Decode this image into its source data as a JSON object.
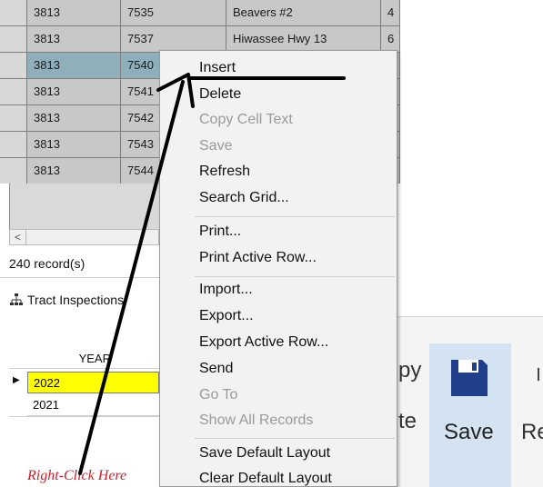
{
  "grid": {
    "rows": [
      {
        "c1": "3813",
        "c2": "7535",
        "c3": "Beavers #2",
        "c4": "4"
      },
      {
        "c1": "3813",
        "c2": "7537",
        "c3": "Hiwassee Hwy 13",
        "c4": "6"
      },
      {
        "c1": "3813",
        "c2": "7540",
        "c3": "",
        "c4": ""
      },
      {
        "c1": "3813",
        "c2": "7541",
        "c3": "",
        "c4": ""
      },
      {
        "c1": "3813",
        "c2": "7542",
        "c3": "",
        "c4": ""
      },
      {
        "c1": "3813",
        "c2": "7543",
        "c3": "",
        "c4": ""
      },
      {
        "c1": "3813",
        "c2": "7544",
        "c3": "",
        "c4": ""
      }
    ],
    "scroll_left_glyph": "<"
  },
  "status": {
    "records": "240 record(s)"
  },
  "tract": {
    "label": "Tract Inspections"
  },
  "years": {
    "header": "YEAR",
    "rows": [
      "2022",
      "2021"
    ],
    "row_indicator": "▶"
  },
  "annotation": {
    "text": "Right-Click Here"
  },
  "context_menu": {
    "items": [
      {
        "label": "Insert",
        "enabled": true
      },
      {
        "label": "Delete",
        "enabled": true
      },
      {
        "label": "Copy Cell Text",
        "enabled": false
      },
      {
        "label": "Save",
        "enabled": false
      },
      {
        "label": "Refresh",
        "enabled": true
      },
      {
        "label": "Search Grid...",
        "enabled": true
      },
      {
        "label": "Print...",
        "enabled": true
      },
      {
        "label": "Print Active Row...",
        "enabled": true
      },
      {
        "label": "Import...",
        "enabled": true
      },
      {
        "label": "Export...",
        "enabled": true
      },
      {
        "label": "Export Active Row...",
        "enabled": true
      },
      {
        "label": "Send",
        "enabled": true
      },
      {
        "label": "Go To",
        "enabled": false
      },
      {
        "label": "Show All Records",
        "enabled": false
      },
      {
        "label": "Save Default Layout",
        "enabled": true
      },
      {
        "label": "Clear Default Layout",
        "enabled": true
      }
    ]
  },
  "ribbon": {
    "save_label": "Save",
    "fragment_left_top": "py",
    "fragment_left_bottom": "te",
    "fragment_right": "Re"
  },
  "colors": {
    "selected_row": "#8fb0bb",
    "year_highlight": "#ffff00",
    "annotation_red": "#cc1f2a",
    "save_icon": "#1f3f8a",
    "ribbon_hover": "#d4e3f2"
  },
  "icons": {
    "save": "floppy-disk-icon",
    "tract": "hierarchy-icon",
    "row_indicator": "row-pointer-icon"
  }
}
